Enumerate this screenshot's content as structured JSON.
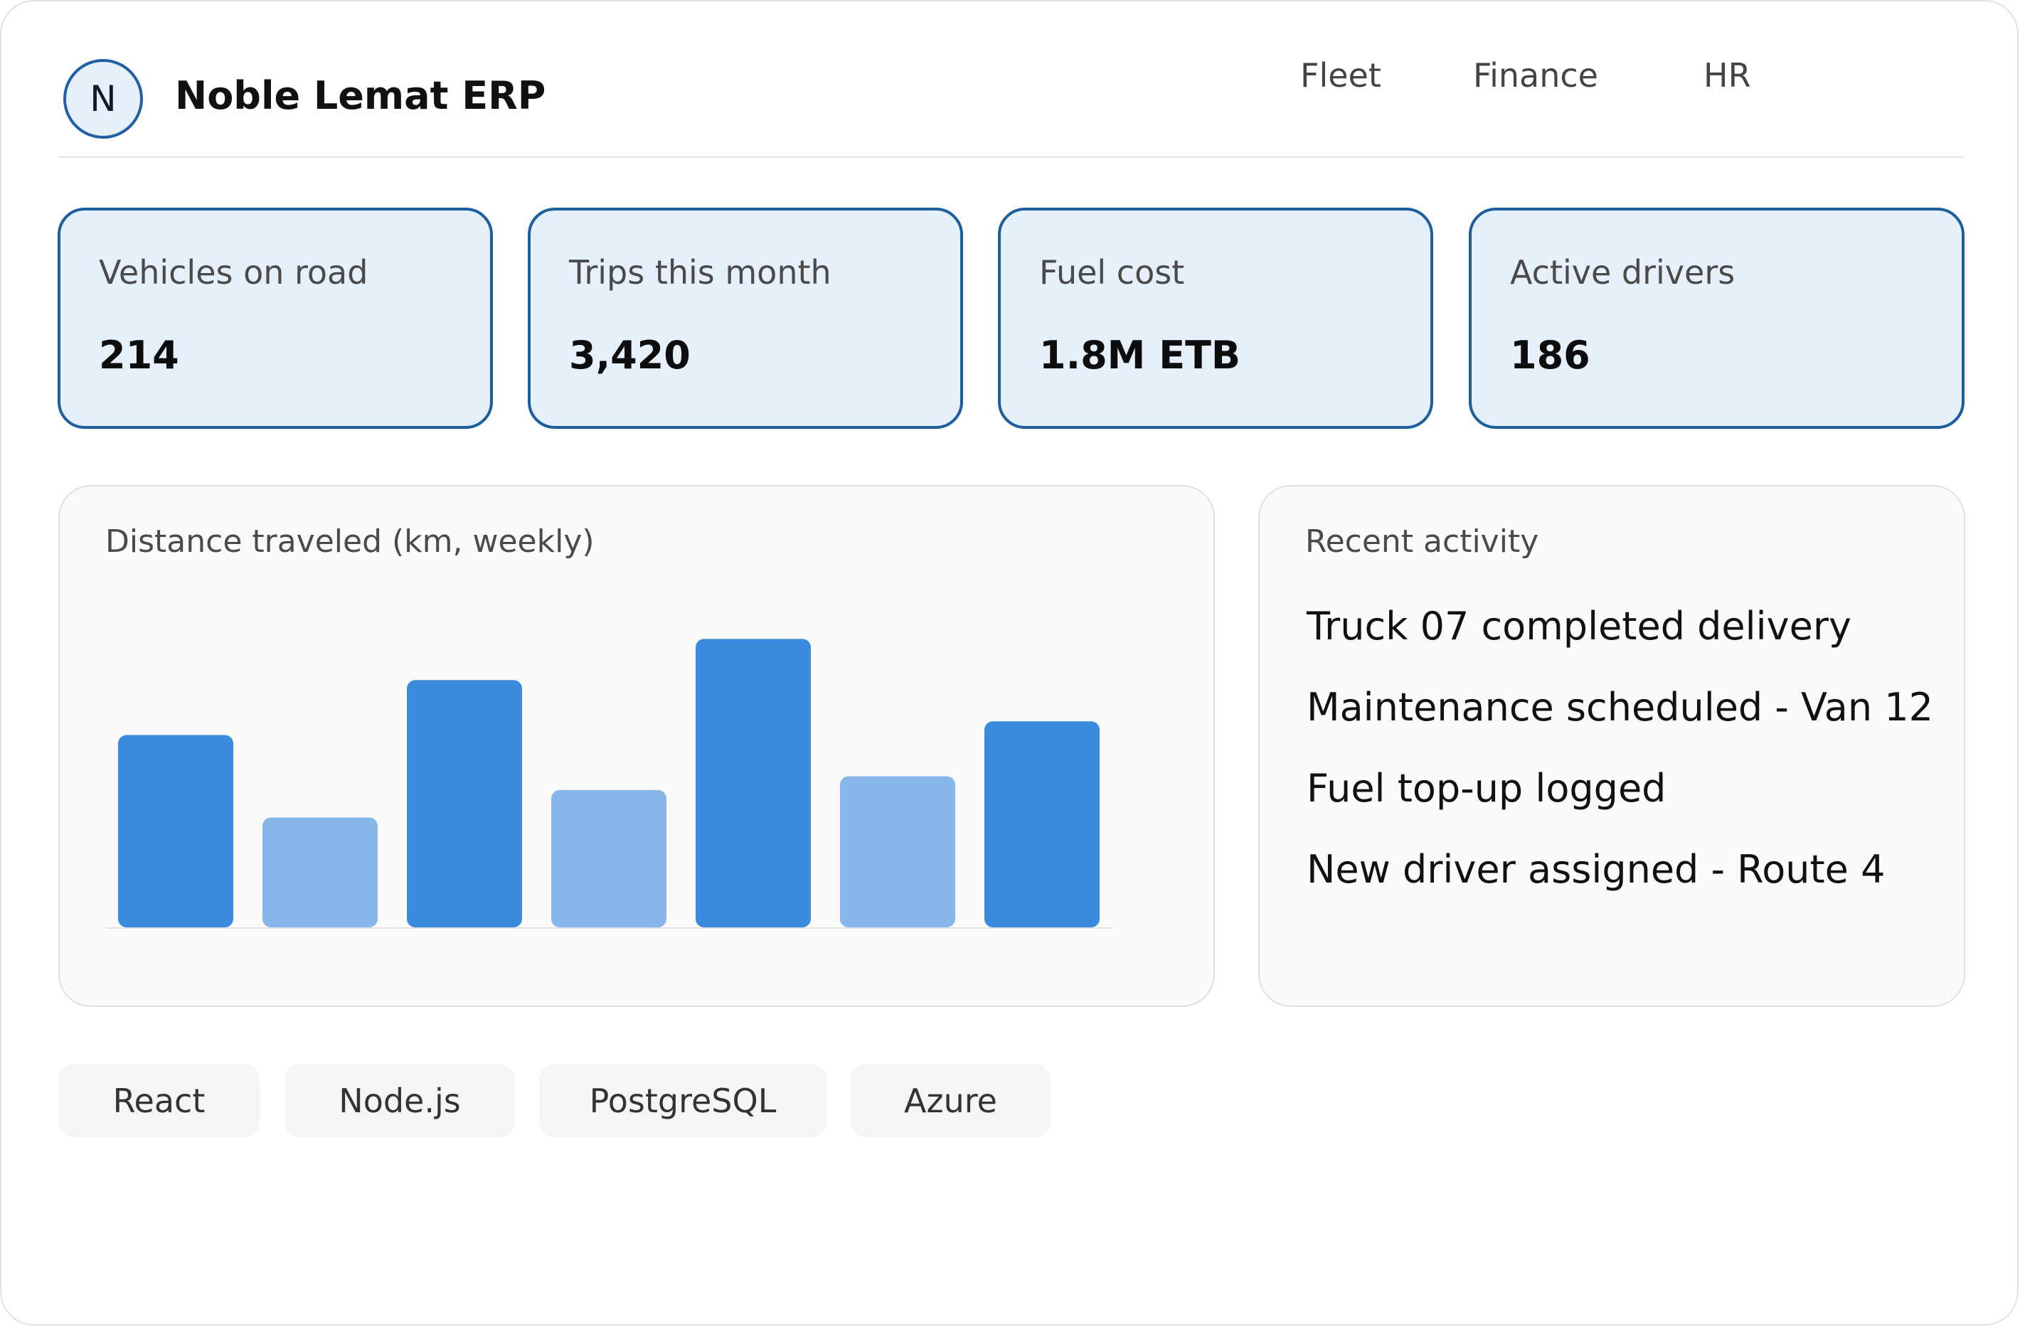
{
  "app": {
    "logo_letter": "N",
    "title": "Noble Lemat ERP"
  },
  "nav": [
    {
      "label": "Fleet"
    },
    {
      "label": "Finance"
    },
    {
      "label": "HR"
    }
  ],
  "kpis": [
    {
      "label": "Vehicles on road",
      "value": "214"
    },
    {
      "label": "Trips this month",
      "value": "3,420"
    },
    {
      "label": "Fuel cost",
      "value": "1.8M ETB"
    },
    {
      "label": "Active drivers",
      "value": "186"
    }
  ],
  "distance_chart": {
    "title": "Distance traveled (km, weekly)"
  },
  "chart_data": {
    "type": "bar",
    "title": "Distance traveled (km, weekly)",
    "categories": [
      "",
      "",
      "",
      "",
      "",
      "",
      ""
    ],
    "values": [
      70,
      40,
      90,
      50,
      105,
      55,
      75
    ],
    "ylim": [
      0,
      110
    ],
    "grid": false,
    "colors": [
      "#3a8bde",
      "#86b6ea",
      "#3a8bde",
      "#86b6ea",
      "#3a8bde",
      "#86b6ea",
      "#3a8bde"
    ]
  },
  "recent_activity": {
    "title": "Recent activity",
    "items": [
      "Truck 07 completed delivery",
      "Maintenance scheduled - Van 12",
      "Fuel top-up logged",
      "New driver assigned - Route 4"
    ]
  },
  "tech_tags": [
    "React",
    "Node.js",
    "PostgreSQL",
    "Azure"
  ],
  "colors": {
    "accent": "#1d5e9f",
    "kpi_background": "#e6f0fa",
    "bar_dark": "#3a8bde",
    "bar_light": "#86b6ea"
  }
}
